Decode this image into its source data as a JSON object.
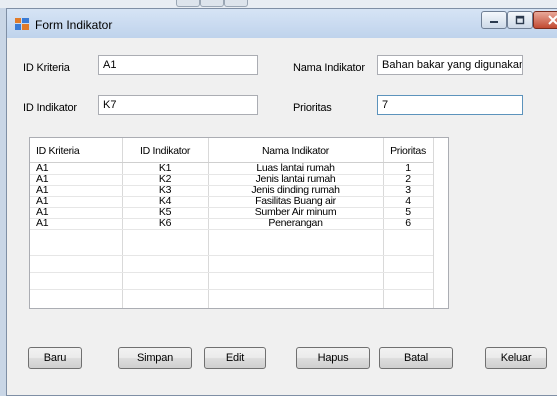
{
  "window": {
    "title": "Form Indikator"
  },
  "form": {
    "id_kriteria_label": "ID Kriteria",
    "id_kriteria_value": "A1",
    "nama_indikator_label": "Nama Indikator",
    "nama_indikator_value": "Bahan bakar yang digunakan",
    "id_indikator_label": "ID Indikator",
    "id_indikator_value": "K7",
    "prioritas_label": "Prioritas",
    "prioritas_value": "7"
  },
  "table": {
    "columns": [
      "ID Kriteria",
      "ID Indikator",
      "Nama Indikator",
      "Prioritas"
    ],
    "rows": [
      [
        "A1",
        "K1",
        "Luas lantai rumah",
        "1"
      ],
      [
        "A1",
        "K2",
        "Jenis lantai rumah",
        "2"
      ],
      [
        "A1",
        "K3",
        "Jenis dinding rumah",
        "3"
      ],
      [
        "A1",
        "K4",
        "Fasilitas Buang air",
        "4"
      ],
      [
        "A1",
        "K5",
        "Sumber Air minum",
        "5"
      ],
      [
        "A1",
        "K6",
        "Penerangan",
        "6"
      ]
    ]
  },
  "buttons": {
    "baru": "Baru",
    "simpan": "Simpan",
    "edit": "Edit",
    "hapus": "Hapus",
    "batal": "Batal",
    "keluar": "Keluar"
  },
  "icons": {
    "app": "form-window-icon",
    "minimize": "minimize-icon",
    "maximize": "maximize-icon",
    "close": "close-icon"
  }
}
